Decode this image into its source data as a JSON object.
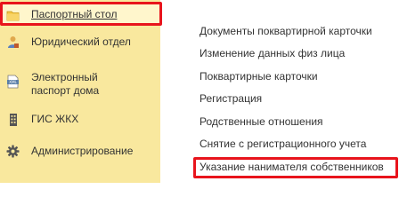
{
  "sidebar": {
    "items": [
      {
        "label": "Паспортный стол",
        "icon": "folder-icon",
        "active": true
      },
      {
        "label": "Юридический отдел",
        "icon": "person-icon"
      },
      {
        "label": "Электронный паспорт дома",
        "icon": "xml-document-icon"
      },
      {
        "label": "ГИС ЖКХ",
        "icon": "building-icon"
      },
      {
        "label": "Администрирование",
        "icon": "gear-icon"
      }
    ]
  },
  "menu": {
    "items": [
      {
        "label": "Документы поквартирной карточки"
      },
      {
        "label": "Изменение данных физ лица"
      },
      {
        "label": "Поквартирные карточки"
      },
      {
        "label": "Регистрация"
      },
      {
        "label": "Родственные отношения"
      },
      {
        "label": "Снятие с регистрационного учета"
      },
      {
        "label": "Указание нанимателя собственников"
      }
    ]
  },
  "colors": {
    "sidebar_bg": "#f9e89e",
    "active_bg": "#fff6cc",
    "highlight": "#e8141c",
    "text": "#333333"
  }
}
